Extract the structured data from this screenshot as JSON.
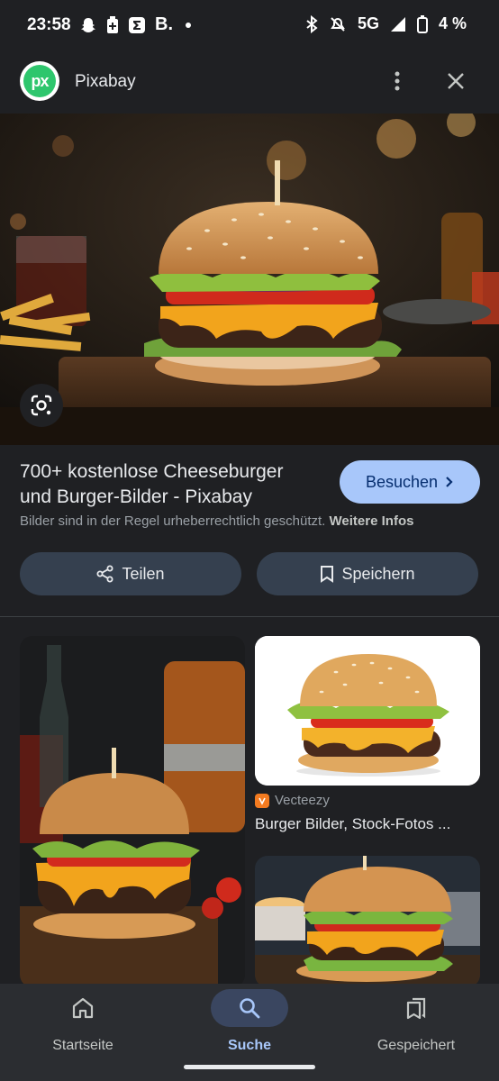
{
  "status": {
    "time": "23:58",
    "network": "5G",
    "battery": "4 %",
    "left_icons": [
      "snapchat-icon",
      "battery-saver-icon",
      "sigma-app-icon",
      "b-app-icon",
      "dot-icon"
    ],
    "right_icons": [
      "bluetooth-icon",
      "mute-icon",
      "signal-icon",
      "battery-icon"
    ]
  },
  "header": {
    "logo_text": "px",
    "site_name": "Pixabay"
  },
  "result": {
    "title": "700+ kostenlose Cheeseburger und Burger-Bilder - Pixabay",
    "visit_label": "Besuchen",
    "copyright_text": "Bilder sind in der Regel urheberrechtlich geschützt.",
    "more_info": "Weitere Infos"
  },
  "actions": {
    "share_label": "Teilen",
    "save_label": "Speichern"
  },
  "related": {
    "source_name": "Vecteezy",
    "caption": "Burger Bilder, Stock-Fotos ..."
  },
  "nav": {
    "items": [
      {
        "label": "Startseite",
        "icon": "home-icon"
      },
      {
        "label": "Suche",
        "icon": "search-icon"
      },
      {
        "label": "Gespeichert",
        "icon": "collections-icon"
      }
    ]
  },
  "colors": {
    "background": "#1f2023",
    "accent": "#a8c7fa",
    "action_button": "#35404f",
    "nav_background": "#2b2d31"
  }
}
